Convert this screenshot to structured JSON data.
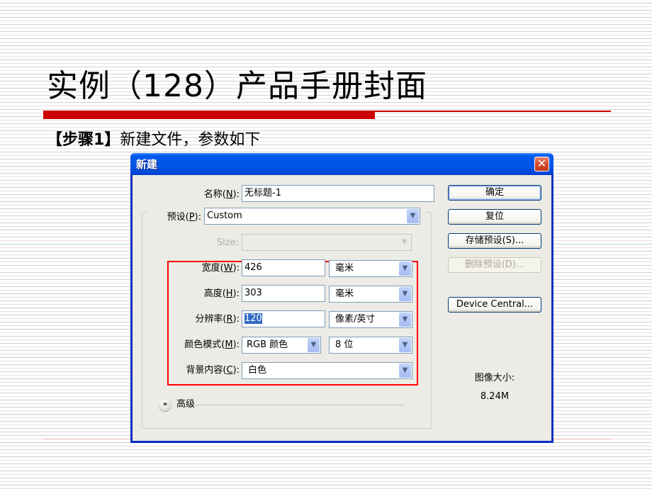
{
  "slide": {
    "title": "实例（128）产品手册封面",
    "step_prefix": "【步骤1】",
    "step_text": "新建文件，参数如下"
  },
  "dialog": {
    "title": "新建",
    "close_icon": "close-icon",
    "fields": {
      "name": {
        "label": "名称(",
        "accel": "N",
        "suffix": "):",
        "value": "无标题-1"
      },
      "preset": {
        "label": "预设(",
        "accel": "P",
        "suffix": "):",
        "value": "Custom"
      },
      "size": {
        "label": "Size:",
        "value": ""
      },
      "width": {
        "label": "宽度(",
        "accel": "W",
        "suffix": "):",
        "value": "426",
        "unit": "毫米"
      },
      "height": {
        "label": "高度(",
        "accel": "H",
        "suffix": "):",
        "value": "303",
        "unit": "毫米"
      },
      "resolution": {
        "label": "分辨率(",
        "accel": "R",
        "suffix": "):",
        "value": "120",
        "unit": "像素/英寸"
      },
      "color_mode": {
        "label": "颜色模式(",
        "accel": "M",
        "suffix": "):",
        "value": "RGB 颜色",
        "bits": "8 位"
      },
      "background": {
        "label": "背景内容(",
        "accel": "C",
        "suffix": "):",
        "value": "白色"
      }
    },
    "buttons": {
      "ok": "确定",
      "reset": "复位",
      "save_preset": "存储预设(S)...",
      "delete_preset": "删除预设(D)...",
      "device_central": "Device Central..."
    },
    "image_size_label": "图像大小:",
    "image_size_value": "8.24M",
    "advanced_label": "高级"
  },
  "colors": {
    "accent_red": "#cc0000",
    "highlight_box": "#ff0000",
    "titlebar_blue": "#0055e5"
  }
}
